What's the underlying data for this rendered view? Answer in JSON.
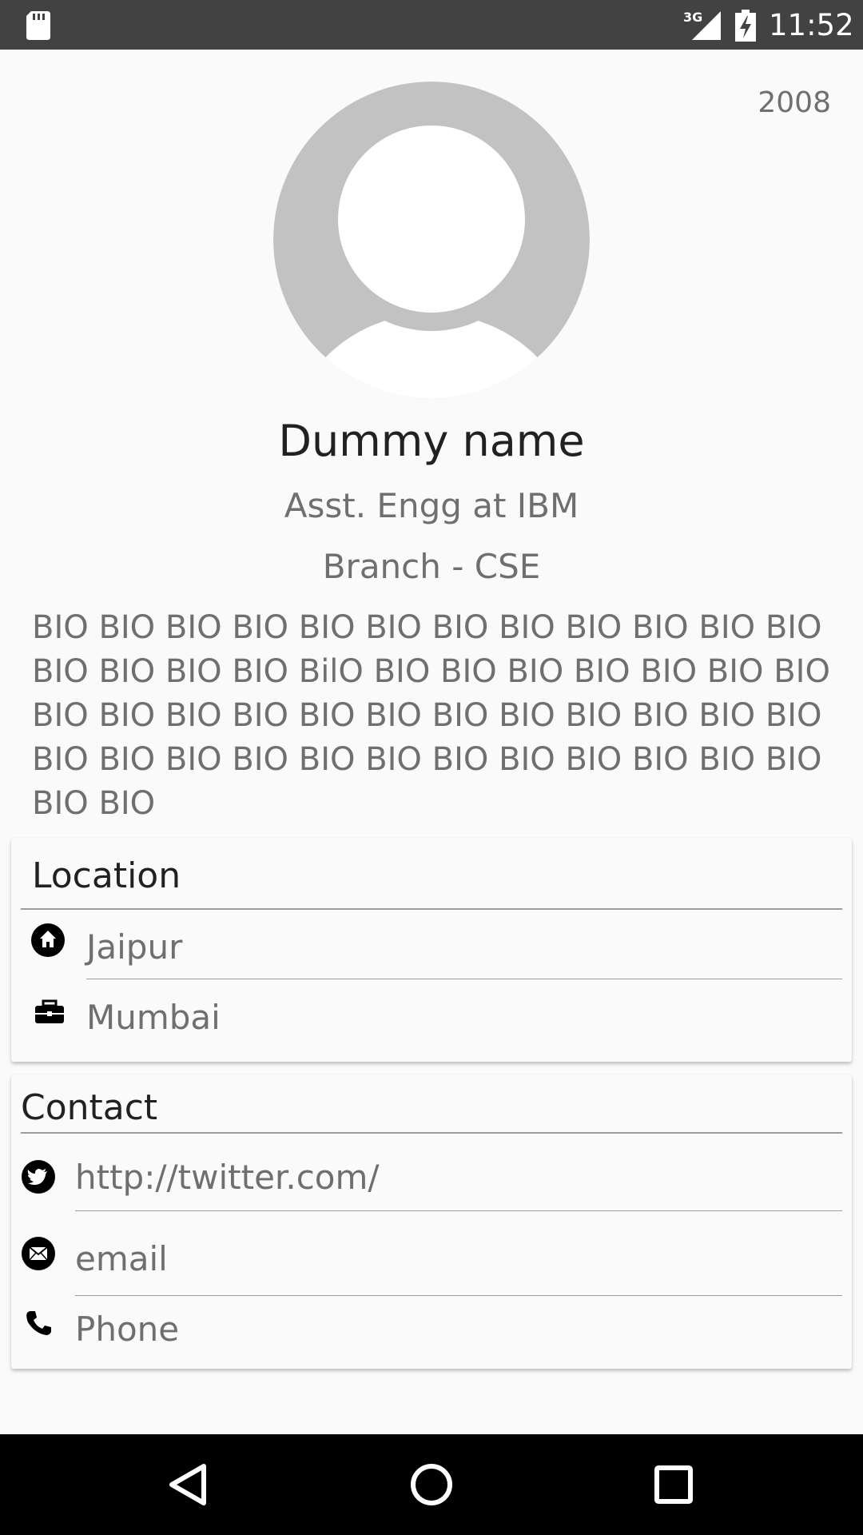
{
  "status_bar": {
    "network": "3G",
    "time": "11:52"
  },
  "profile": {
    "year": "2008",
    "name": "Dummy name",
    "job": "Asst. Engg at IBM",
    "branch": "Branch - CSE",
    "bio": "BIO BIO BIO BIO BIO BIO BIO BIO BIO BIO BIO BIO BIO BIO BIO BIO BilO BIO BIO BIO BIO BIO BIO BIO BIO BIO BIO BIO BIO BIO BIO BIO BIO BIO BIO BIO BIO BIO BIO BIO BIO BIO BIO BIO BIO BIO BIO BIO BIO BIO"
  },
  "location": {
    "title": "Location",
    "home": "Jaipur",
    "work": "Mumbai"
  },
  "contact": {
    "title": "Contact",
    "twitter": "http://twitter.com/",
    "email": "email",
    "phone": "Phone"
  },
  "icons": {
    "sd_card": "sd-card-icon",
    "signal": "signal-icon",
    "battery": "battery-charging-icon",
    "avatar": "avatar-placeholder",
    "home": "home-icon",
    "work": "briefcase-icon",
    "twitter": "twitter-icon",
    "email": "email-icon",
    "phone": "phone-icon",
    "nav_back": "back-icon",
    "nav_home": "home-circle-icon",
    "nav_recents": "recents-icon"
  },
  "colors": {
    "status_bar": "#424242",
    "background": "#fafafa",
    "primary_text": "#212121",
    "secondary_text": "#6f6f6f",
    "avatar_gray": "#c2c2c2"
  }
}
